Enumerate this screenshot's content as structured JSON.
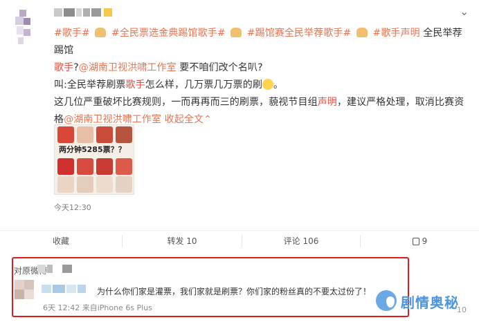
{
  "post": {
    "tag1": "#歌手#",
    "tag2": "#全民票选金典踢馆歌手#",
    "tag3": "#踢馆赛全民举荐歌手#",
    "tag4": "#歌手声明",
    "line1_tail": "全民举荐踢馆",
    "line2_head": "歌手",
    "line2_q": "?",
    "mention": "@湖南卫视洪啸工作室",
    "line2_tail": " 要不咱们改个名叭?",
    "line3_a": "叫:全民举荐刷票",
    "line3_b": "歌手",
    "line3_c": "怎么样，几万票几万票的刷",
    "line3_d": "。",
    "line4_a": "这几位严重破坏比赛规则，一而再再而三的刷票，藐视节目组",
    "line4_b": "声明",
    "line4_c": "，建议严格处理，取消比赛资",
    "line5_a": "格",
    "line5_mention": "@湖南卫视洪啸工作室",
    "expand": " 收起全文",
    "expand_icon": "chevron-up-icon",
    "image_caption": "两分钟5285票？？",
    "time": "今天12:30"
  },
  "actions": {
    "collect": "收藏",
    "forward": "转发 10",
    "comment": "评论 106",
    "like": "9"
  },
  "comment": {
    "title": "对原微博",
    "text": "为什么你们家是灌票，我们家就是刷票？你们家的粉丝真的不要太过份了！",
    "time": "6天 12:42 来自iPhone 6s Plus",
    "count": "10"
  },
  "watermark": {
    "text": "剧情奥秘"
  },
  "colors": {
    "accent": "#eb7350",
    "highlight_box": "#e01919",
    "watermark": "#4d95dd"
  }
}
